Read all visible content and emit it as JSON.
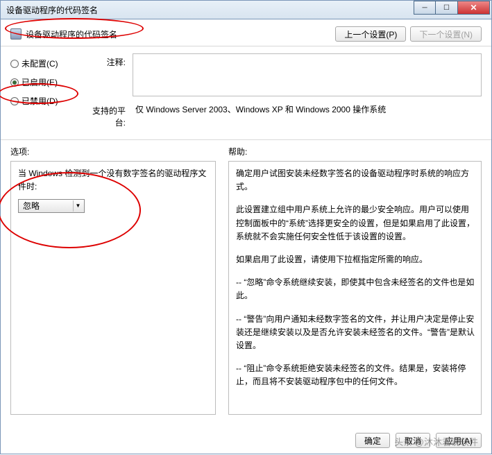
{
  "titlebar": {
    "text": "设备驱动程序的代码签名"
  },
  "header": {
    "title": "设备驱动程序的代码签名",
    "prev": "上一个设置(P)",
    "next": "下一个设置(N)"
  },
  "radios": {
    "unconfigured": "未配置(C)",
    "enabled": "已启用(E)",
    "disabled": "已禁用(D)"
  },
  "fields": {
    "comment_label": "注释:",
    "platform_label": "支持的平台:",
    "platform_text": "仅 Windows Server 2003、Windows XP 和 Windows 2000 操作系统"
  },
  "sections": {
    "options_label": "选项:",
    "help_label": "帮助:"
  },
  "options": {
    "prompt": "当 Windows 检测到一个没有数字签名的驱动程序文件时:",
    "combo_value": "忽略"
  },
  "help": {
    "p1": "确定用户试图安装未经数字签名的设备驱动程序时系统的响应方式。",
    "p2": "此设置建立组中用户系统上允许的最少安全响应。用户可以使用控制面板中的“系统”选择更安全的设置，但是如果启用了此设置，系统就不会实施任何安全性低于该设置的设置。",
    "p3": "如果启用了此设置，请使用下拉框指定所需的响应。",
    "p4": "-- “忽略”命令系统继续安装，即使其中包含未经签名的文件也是如此。",
    "p5": "-- “警告”向用户通知未经数字签名的文件，并让用户决定是停止安装还是继续安装以及是否允许安装未经签名的文件。“警告”是默认设置。",
    "p6": "-- “阻止”命令系统拒绝安装未经签名的文件。结果是，安装将停止，而且将不安装驱动程序包中的任何文件。"
  },
  "buttons": {
    "ok": "确定",
    "cancel": "取消",
    "apply": "应用(A)"
  },
  "watermark": "头条 @沐沐君说软件"
}
